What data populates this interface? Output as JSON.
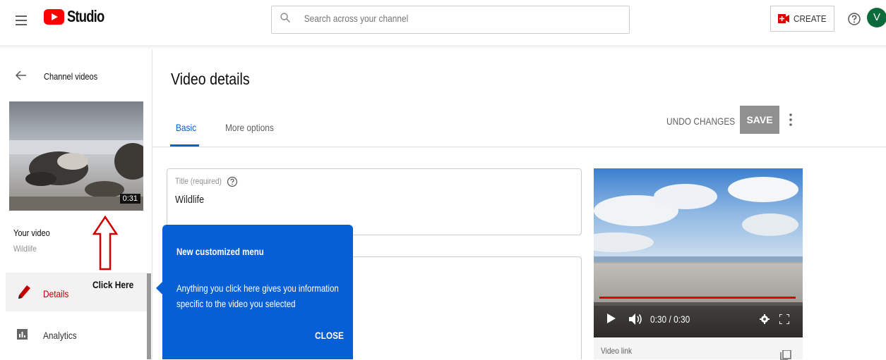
{
  "header": {
    "logo_text": "Studio",
    "search_placeholder": "Search across your channel",
    "create_label": "CREATE",
    "avatar_letter": "V"
  },
  "sidebar": {
    "back_label": "Channel videos",
    "thumbnail_duration": "0:31",
    "your_video_label": "Your video",
    "video_title": "Wildlife",
    "items": [
      {
        "label": "Details",
        "icon": "pencil-icon",
        "active": true
      },
      {
        "label": "Analytics",
        "icon": "analytics-icon",
        "active": false
      }
    ]
  },
  "annotation": {
    "click_here": "Click Here"
  },
  "main": {
    "page_title": "Video details",
    "tabs": [
      {
        "label": "Basic",
        "active": true
      },
      {
        "label": "More options",
        "active": false
      }
    ],
    "undo_label": "UNDO CHANGES",
    "save_label": "SAVE",
    "title_field": {
      "caption": "Title (required)",
      "value": "Wildlife"
    },
    "player": {
      "time": "0:30 / 0:30",
      "progress": 1.0
    },
    "video_link_label": "Video link"
  },
  "tooltip": {
    "title": "New customized menu",
    "body": "Anything you click here gives you information specific to the video you selected",
    "close_label": "CLOSE"
  },
  "colors": {
    "accent": "#065fd4",
    "brand_red": "#ff0000",
    "active_text": "#c00000",
    "save_disabled": "#909090"
  }
}
